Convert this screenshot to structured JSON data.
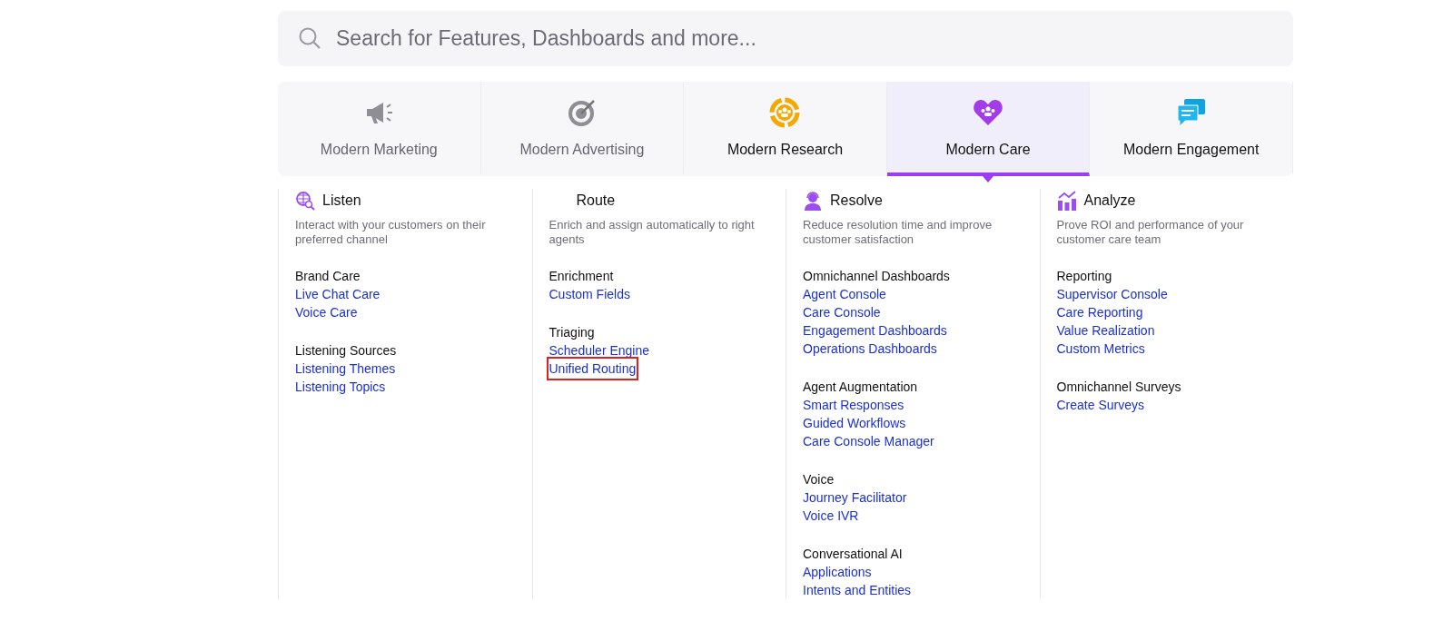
{
  "search": {
    "placeholder": "Search for Features, Dashboards and more..."
  },
  "tabs": [
    {
      "label": "Modern Marketing",
      "selected": false,
      "dimmed": true
    },
    {
      "label": "Modern Advertising",
      "selected": false,
      "dimmed": true
    },
    {
      "label": "Modern Research",
      "selected": false,
      "dimmed": false
    },
    {
      "label": "Modern Care",
      "selected": true,
      "dimmed": false
    },
    {
      "label": "Modern Engagement",
      "selected": false,
      "dimmed": false
    }
  ],
  "columns": [
    {
      "title": "Listen",
      "description": "Interact with your customers on their preferred channel",
      "groups": [
        {
          "heading": "Brand Care",
          "links": [
            {
              "label": "Live Chat Care",
              "highlighted": false
            },
            {
              "label": "Voice Care",
              "highlighted": false
            }
          ]
        },
        {
          "heading": "Listening Sources",
          "links": [
            {
              "label": "Listening Themes",
              "highlighted": false
            },
            {
              "label": "Listening Topics",
              "highlighted": false
            }
          ]
        }
      ]
    },
    {
      "title": "Route",
      "description": "Enrich and assign automatically to right agents",
      "groups": [
        {
          "heading": "Enrichment",
          "links": [
            {
              "label": "Custom Fields",
              "highlighted": false
            }
          ]
        },
        {
          "heading": "Triaging",
          "links": [
            {
              "label": "Scheduler Engine",
              "highlighted": false
            },
            {
              "label": "Unified Routing",
              "highlighted": true
            }
          ]
        }
      ]
    },
    {
      "title": "Resolve",
      "description": "Reduce resolution time and improve customer satisfaction",
      "groups": [
        {
          "heading": "Omnichannel Dashboards",
          "links": [
            {
              "label": "Agent Console",
              "highlighted": false
            },
            {
              "label": "Care Console",
              "highlighted": false
            },
            {
              "label": "Engagement Dashboards",
              "highlighted": false
            },
            {
              "label": "Operations Dashboards",
              "highlighted": false
            }
          ]
        },
        {
          "heading": "Agent Augmentation",
          "links": [
            {
              "label": "Smart Responses",
              "highlighted": false
            },
            {
              "label": "Guided Workflows",
              "highlighted": false
            },
            {
              "label": "Care Console Manager",
              "highlighted": false
            }
          ]
        },
        {
          "heading": "Voice",
          "links": [
            {
              "label": "Journey Facilitator",
              "highlighted": false
            },
            {
              "label": "Voice IVR",
              "highlighted": false
            }
          ]
        },
        {
          "heading": "Conversational AI",
          "links": [
            {
              "label": "Applications",
              "highlighted": false
            },
            {
              "label": "Intents and Entities",
              "highlighted": false
            }
          ]
        }
      ]
    },
    {
      "title": "Analyze",
      "description": "Prove ROI and performance of your customer care team",
      "groups": [
        {
          "heading": "Reporting",
          "links": [
            {
              "label": "Supervisor Console",
              "highlighted": false
            },
            {
              "label": "Care Reporting",
              "highlighted": false
            },
            {
              "label": "Value Realization",
              "highlighted": false
            },
            {
              "label": "Custom Metrics",
              "highlighted": false
            }
          ]
        },
        {
          "heading": "Omnichannel Surveys",
          "links": [
            {
              "label": "Create Surveys",
              "highlighted": false
            }
          ]
        }
      ]
    }
  ]
}
